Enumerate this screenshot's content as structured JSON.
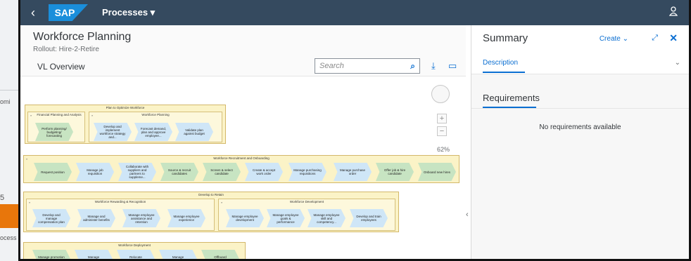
{
  "background_app": {
    "text_top": "omi",
    "number": "5",
    "text_bottom": "ocess"
  },
  "shell": {
    "back_icon": "back-icon",
    "logo": "SAP",
    "title": "Processes ▾",
    "user_icon": "user-icon",
    "color": "#354a5f"
  },
  "header": {
    "title": "Workforce Planning",
    "subtitle": "Rollout: Hire-2-Retire"
  },
  "toolbar": {
    "view_label": "VL Overview",
    "search_placeholder": "Search",
    "download_icon": "download-icon",
    "comment_icon": "comment-icon"
  },
  "diagram": {
    "zoom": "62%",
    "zoom_in": "+",
    "zoom_out": "−",
    "groups": [
      {
        "label": "Plan to Optimize Workforce",
        "subgroups": [
          {
            "label": "Financial Planning and Analysis",
            "steps": [
              "Perform planning/ budgeting/ forecasting"
            ]
          },
          {
            "label": "Workforce Planning",
            "steps": [
              "Develop and implement workforce strategy and...",
              "Forecast demand, plan and approve employee...",
              "Validate plan against budget"
            ]
          }
        ]
      },
      {
        "label": "Workforce Recruitment and Onboarding",
        "steps": [
          "Request position",
          "Manage job requisition",
          "Collaborate with suppliers and partners to suppleme...",
          "Source & recruit candidates",
          "Screen & select candidate",
          "Create & accept work order",
          "Manage purchasing requisitions",
          "Manage purchase order",
          "Offer job & hire candidate",
          "Onboard new hires"
        ]
      },
      {
        "label": "Develop to Retain",
        "subgroups": [
          {
            "label": "Workforce Rewarding & Recognition",
            "steps": [
              "Develop and manage compensation plan",
              "Manage and administer benefits",
              "Manage employee assistance and retention",
              "Manage employee experience"
            ]
          },
          {
            "label": "Workforce Development",
            "steps": [
              "Manage employee development",
              "Manage employee goals & performance",
              "Manage employee skill and competency...",
              "Develop and train employees"
            ]
          }
        ]
      },
      {
        "label": "Workforce Deployment",
        "steps": [
          "Manage promotion and demotio...",
          "Manage workforce...",
          "Relocate employees...",
          "Manage separation...",
          "Offboard employee..."
        ]
      }
    ]
  },
  "summary": {
    "title": "Summary",
    "create_label": "Create ⌄",
    "fullscreen_icon": "fullscreen-icon",
    "close_icon": "close-icon",
    "tab_label": "Description",
    "requirements_title": "Requirements",
    "requirements_empty": "No requirements available"
  },
  "colors": {
    "accent": "#0a6ed1",
    "group_fill": "#fbf3c7",
    "step_green": "#c7e4c2",
    "step_blue": "#cfe6f7"
  }
}
